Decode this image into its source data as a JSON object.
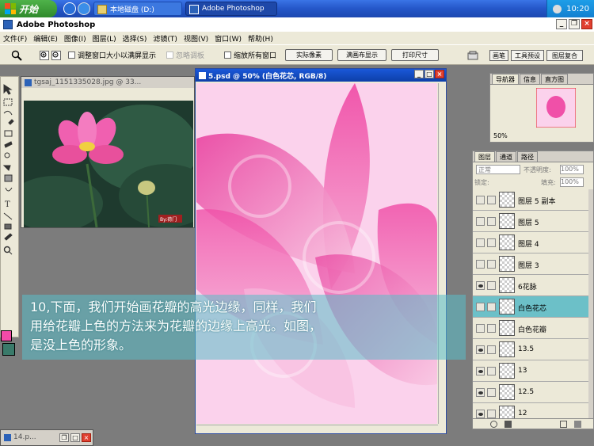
{
  "taskbar": {
    "start_label": "开始",
    "task_buttons": [
      {
        "label": "本地磁盘 (D:)"
      },
      {
        "label": "Adobe Photoshop"
      }
    ],
    "clock": "10:20"
  },
  "app": {
    "title": "Adobe Photoshop"
  },
  "menu": {
    "items": [
      "文件(F)",
      "编辑(E)",
      "图像(I)",
      "图层(L)",
      "选择(S)",
      "滤镜(T)",
      "视图(V)",
      "窗口(W)",
      "帮助(H)"
    ]
  },
  "options": {
    "resize_windows_label": "调整窗口大小以满屏显示",
    "ignore_palettes_label": "忽略调板",
    "zoom_all_label": "缩放所有窗口",
    "actual_pixels_label": "实际像素",
    "fit_screen_label": "满画布显示",
    "print_size_label": "打印尺寸",
    "dock_tabs": [
      "画笔",
      "工具预设",
      "图层复合"
    ]
  },
  "doc_bg": {
    "title": "tgsaj_1151335028.jpg @ 33...",
    "watermark": "By:荷门"
  },
  "doc_main": {
    "title": "5.psd @ 50% (白色花芯, RGB/8)"
  },
  "navigator": {
    "tabs": [
      "导航器",
      "信息",
      "直方图"
    ],
    "zoom": "50%"
  },
  "layers_panel": {
    "tabs": [
      "图层",
      "通道",
      "路径"
    ],
    "blend_mode": "正常",
    "opacity_label": "不透明度:",
    "opacity_value": "100%",
    "lock_label": "锁定:",
    "fill_label": "填充:",
    "fill_value": "100%",
    "layers": [
      {
        "name": "图层 5 副本",
        "visible": false,
        "selected": false
      },
      {
        "name": "图层 5",
        "visible": false,
        "selected": false
      },
      {
        "name": "图层 4",
        "visible": false,
        "selected": false
      },
      {
        "name": "图层 3",
        "visible": false,
        "selected": false
      },
      {
        "name": "6花脉",
        "visible": true,
        "selected": false
      },
      {
        "name": "白色花芯",
        "visible": false,
        "selected": true
      },
      {
        "name": "白色花瓣",
        "visible": false,
        "selected": false
      },
      {
        "name": "13.5",
        "visible": true,
        "selected": false
      },
      {
        "name": "13",
        "visible": true,
        "selected": false
      },
      {
        "name": "12.5",
        "visible": true,
        "selected": false
      },
      {
        "name": "12",
        "visible": true,
        "selected": false
      }
    ]
  },
  "caption": {
    "line1": "10,下面，我们开始画花瓣的高光边缘，同样，我们",
    "line2": "用给花瓣上色的方法来为花瓣的边缘上高光。如图，",
    "line3": "是没上色的形象。"
  },
  "bottom_doc": {
    "title": "14.p..."
  },
  "colors": {
    "foreground": "#f24aa8",
    "background": "#3a7a6a",
    "accent_selected_layer": "#6cc0c8"
  }
}
